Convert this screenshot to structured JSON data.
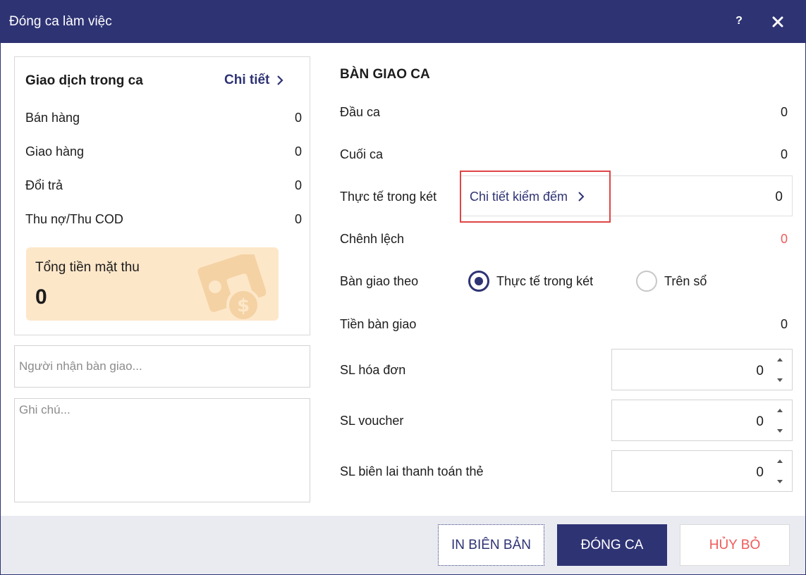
{
  "window": {
    "title": "Đóng ca làm việc",
    "help_label": "?",
    "close_icon": "close-icon"
  },
  "transactions": {
    "title": "Giao dịch trong ca",
    "detail_link": "Chi tiết",
    "rows": [
      {
        "label": "Bán hàng",
        "value": "0"
      },
      {
        "label": "Giao hàng",
        "value": "0"
      },
      {
        "label": "Đổi trả",
        "value": "0"
      },
      {
        "label": "Thu nợ/Thu COD",
        "value": "0"
      }
    ],
    "cash_total": {
      "label": "Tổng tiền mặt thu",
      "value": "0",
      "icon": "money-icon"
    }
  },
  "receiver": {
    "placeholder": "Người nhận bàn giao...",
    "value": ""
  },
  "note": {
    "placeholder": "Ghi chú...",
    "value": ""
  },
  "handover": {
    "title": "BÀN GIAO CA",
    "start": {
      "label": "Đầu ca",
      "value": "0"
    },
    "end": {
      "label": "Cuối ca",
      "value": "0"
    },
    "actual": {
      "label": "Thực tế trong két",
      "link": "Chi tiết kiểm đếm",
      "value": "0"
    },
    "difference": {
      "label": "Chênh lệch",
      "value": "0"
    },
    "mode": {
      "label": "Bàn giao theo",
      "options": [
        {
          "label": "Thực tế trong két",
          "selected": true
        },
        {
          "label": "Trên sổ",
          "selected": false
        }
      ]
    },
    "handover_amount": {
      "label": "Tiền bàn giao",
      "value": "0"
    },
    "counters": [
      {
        "label": "SL hóa đơn",
        "value": "0"
      },
      {
        "label": "SL voucher",
        "value": "0"
      },
      {
        "label": "SL biên lai thanh toán thẻ",
        "value": "0"
      }
    ]
  },
  "footer": {
    "print_label": "IN BIÊN BẢN",
    "close_shift_label": "ĐÓNG CA",
    "cancel_label": "HỦY BỎ"
  },
  "colors": {
    "primary": "#2e3374",
    "danger": "#f05a5a",
    "highlight_border": "#e04545",
    "cash_card_bg": "#fde7c9",
    "footer_bg": "#e9ebf1"
  }
}
